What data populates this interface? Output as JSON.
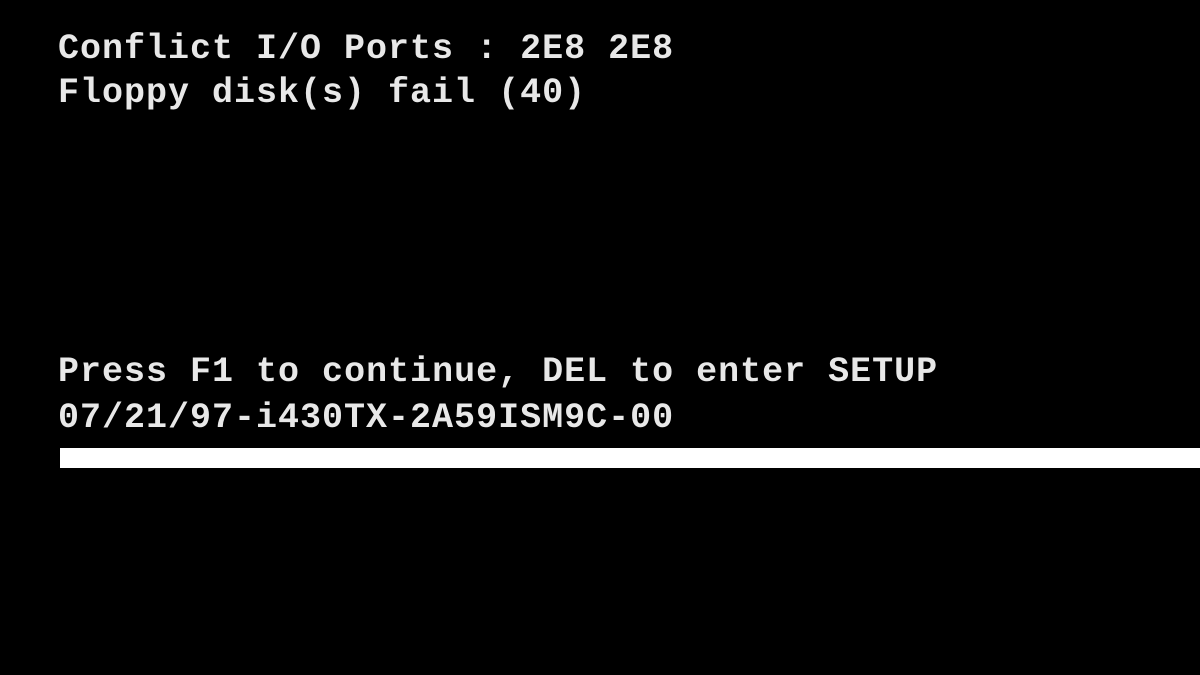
{
  "errors": {
    "conflict_line": "Conflict I/O Ports : 2E8 2E8",
    "floppy_line": "Floppy disk(s) fail (40)"
  },
  "prompt": {
    "press_prefix": "Press ",
    "key1": "F1",
    "mid1": " to continue, ",
    "key2": "DEL",
    "mid2": " to enter SETUP"
  },
  "bios_id": "07/21/97-i430TX-2A59ISM9C-00"
}
